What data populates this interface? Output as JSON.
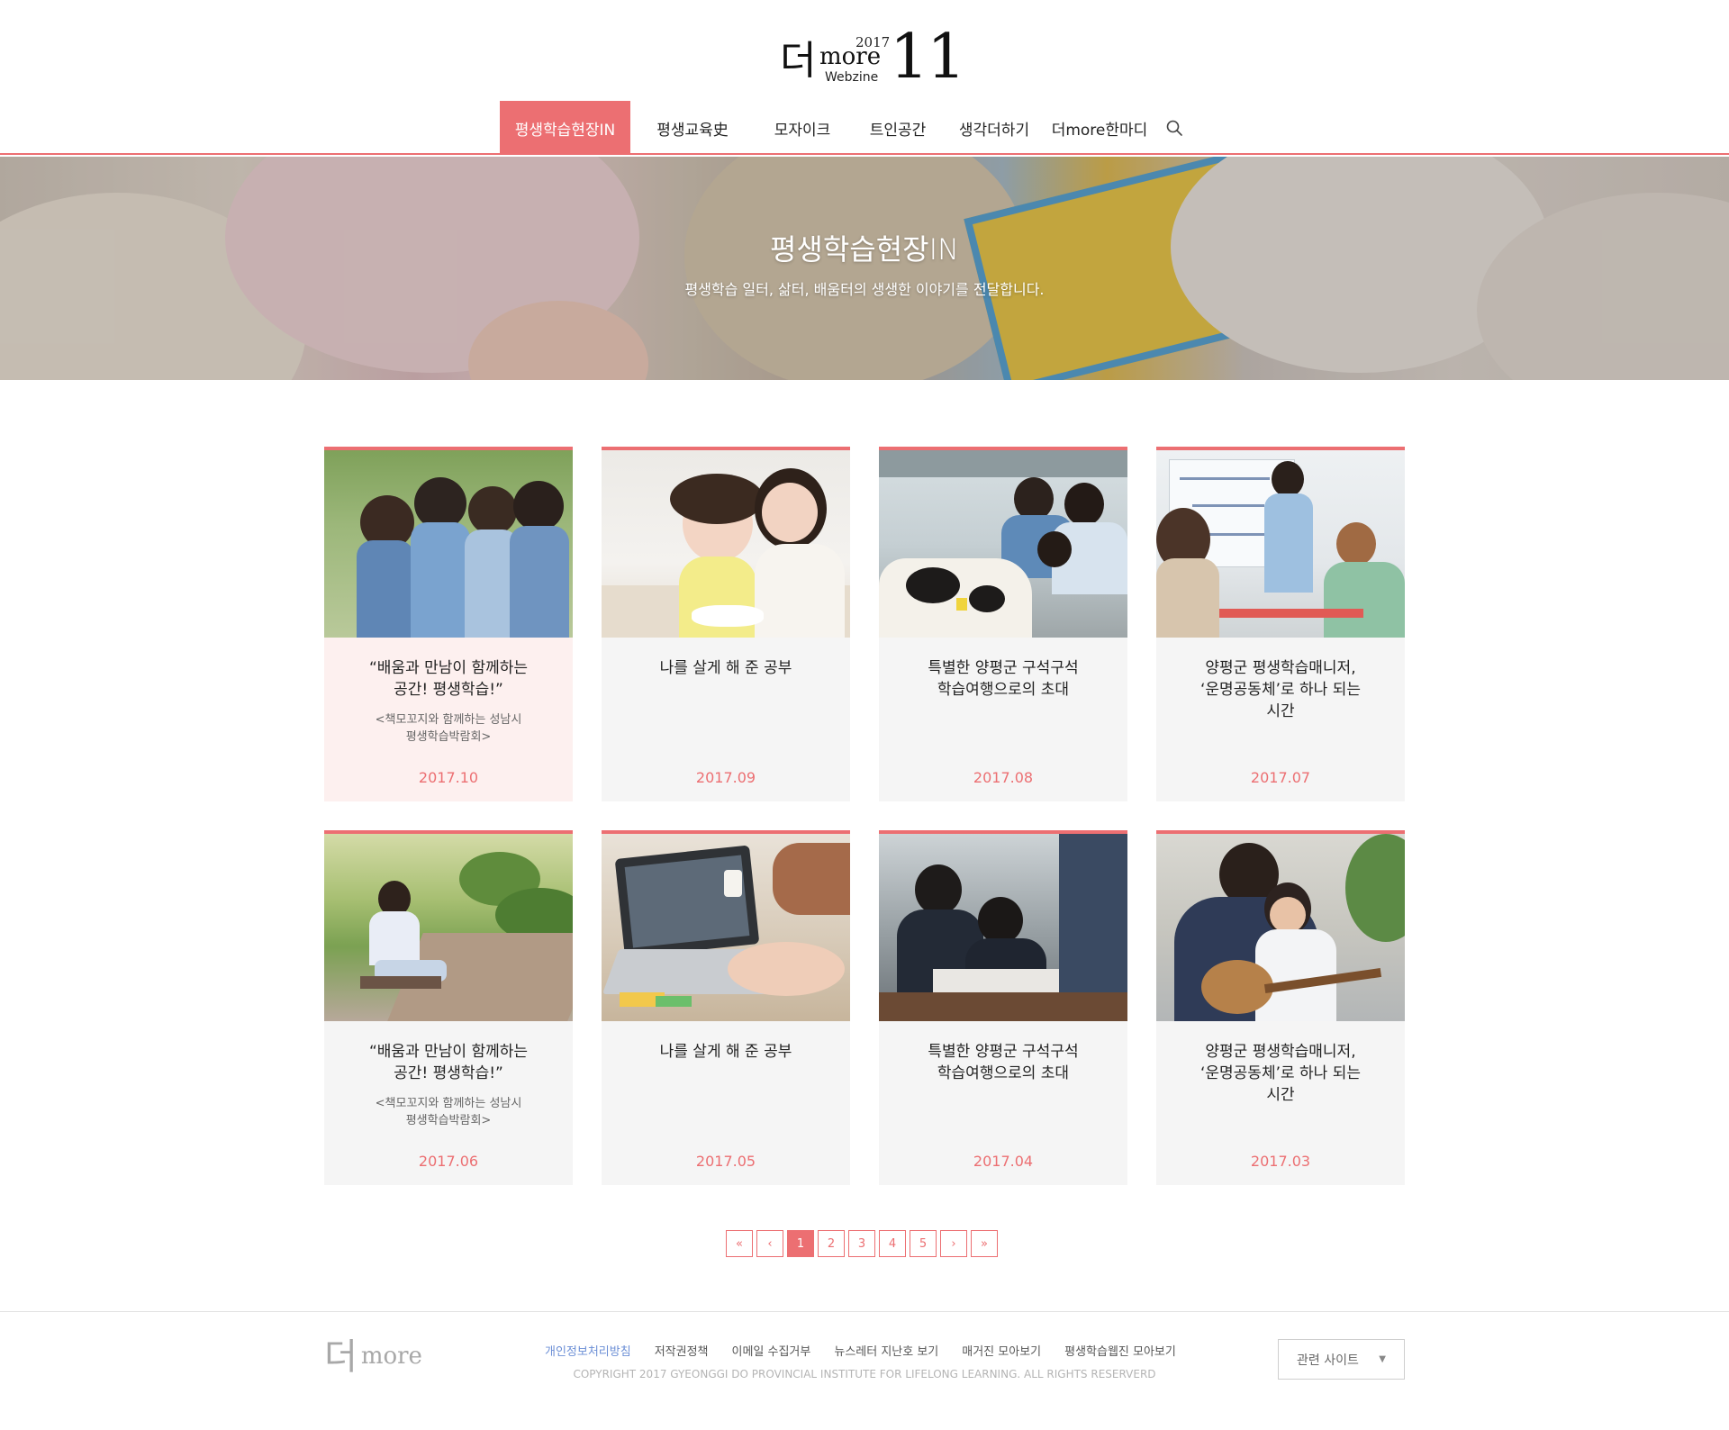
{
  "logo": {
    "han": "더",
    "year": "2017",
    "more": "more",
    "webzine": "Webzine",
    "issue": "11"
  },
  "nav": {
    "items": [
      {
        "label": "평생학습현장IN",
        "active": true
      },
      {
        "label": "평생교육史",
        "active": false
      },
      {
        "label": "모자이크",
        "active": false
      },
      {
        "label": "트인공간",
        "active": false
      },
      {
        "label": "생각더하기",
        "active": false
      },
      {
        "label": "더more한마디",
        "active": false
      }
    ],
    "search_icon": "search-icon"
  },
  "hero": {
    "title": "평생학습현장IN",
    "subtitle": "평생학습 일터, 삶터, 배움터의 생생한 이야기를 전달합니다."
  },
  "cards": [
    {
      "title": "“배움과 만남이 함께하는\n공간! 평생학습!”",
      "subtitle": "<책모꼬지와 함께하는 성남시\n평생학습박람회>",
      "date": "2017.10"
    },
    {
      "title": "나를 살게 해 준 공부",
      "subtitle": "",
      "date": "2017.09"
    },
    {
      "title": "특별한 양평군 구석구석\n학습여행으로의 초대",
      "subtitle": "",
      "date": "2017.08"
    },
    {
      "title": "양평군 평생학습매니저,\n‘운명공동체’로 하나 되는\n시간",
      "subtitle": "",
      "date": "2017.07"
    },
    {
      "title": "“배움과 만남이 함께하는\n공간! 평생학습!”",
      "subtitle": "<책모꼬지와 함께하는 성남시\n평생학습박람회>",
      "date": "2017.06"
    },
    {
      "title": "나를 살게 해 준 공부",
      "subtitle": "",
      "date": "2017.05"
    },
    {
      "title": "특별한 양평군 구석구석\n학습여행으로의 초대",
      "subtitle": "",
      "date": "2017.04"
    },
    {
      "title": "양평군 평생학습매니저,\n‘운명공동체’로 하나 되는\n시간",
      "subtitle": "",
      "date": "2017.03"
    }
  ],
  "pagination": {
    "first": "«",
    "prev": "‹",
    "pages": [
      "1",
      "2",
      "3",
      "4",
      "5"
    ],
    "current": "1",
    "next": "›",
    "last": "»"
  },
  "footer": {
    "logo_han": "더",
    "logo_more": "more",
    "links": [
      "개인정보처리방침",
      "저작권정책",
      "이메일 수집거부",
      "뉴스레터 지난호 보기",
      "매거진 모아보기",
      "평생학습웹진 모아보기"
    ],
    "copyright": "COPYRIGHT 2017 GYEONGGI DO PROVINCIAL INSTITUTE FOR LIFELONG LEARNING. ALL RIGHTS RESERVERD",
    "related_sites": "관련 사이트",
    "related_arrow": "▼"
  },
  "colors": {
    "accent": "#ec6f72",
    "card_bg": "#f5f5f5",
    "card_highlight_bg": "#fdf0ef",
    "footer_link_highlight": "#6c8fd6"
  }
}
